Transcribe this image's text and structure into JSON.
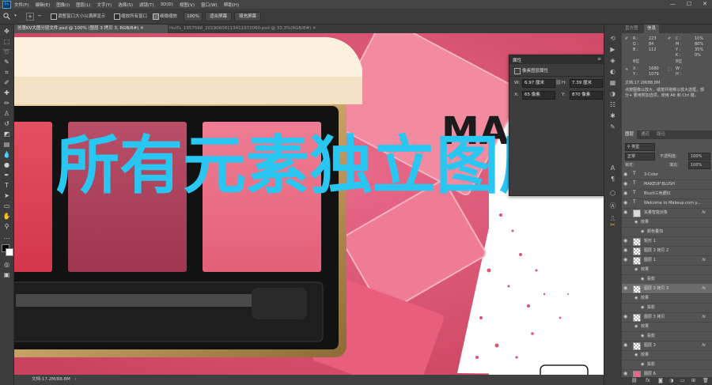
{
  "app": {
    "logo": "Ps",
    "icon_colors": {
      "logo_bg": "#0a3a63",
      "logo_fg": "#31a8ff"
    }
  },
  "menu": [
    "文件(F)",
    "编辑(E)",
    "图像(I)",
    "图层(L)",
    "文字(Y)",
    "选择(S)",
    "滤镜(T)",
    "3D(D)",
    "视图(V)",
    "窗口(W)",
    "帮助(H)"
  ],
  "window_controls": {
    "minimize": "—",
    "maximize": "☐",
    "close": "✕"
  },
  "options": {
    "resize_windows": "调整窗口大小以满屏显示",
    "zoom_all": "缩放所有窗口",
    "scrubby_zoom": "细微缩放",
    "zoom_value": "100%",
    "fit_screen": "适合屏幕",
    "fill_screen": "填充屏幕"
  },
  "tabs": [
    {
      "label": "创意KV大图分层文件.psd @ 100% (图层 3 拷贝 3, RGB/8#) ✕"
    },
    {
      "label": "HuiTu_1957566_20190608113411972060.psd @ 33.3%(RGB/8#) ✕"
    }
  ],
  "canvas": {
    "overlay_text": "所有元素独立图层",
    "overlay_color": "#29c6f2",
    "headline_partial": "MA"
  },
  "status": {
    "text": "文档:17.2M/88.8M",
    "arrow": "›"
  },
  "histogram_panel": {
    "tabs": [
      "直方图",
      "信息"
    ],
    "r_label": "R :",
    "r": "223",
    "g_label": "G :",
    "g": "84",
    "b_label": "B :",
    "b": "112",
    "c_label": "C :",
    "c": "10%",
    "m_label": "M :",
    "m": "80%",
    "y_label": "Y :",
    "y": "35%",
    "k_label": "K :",
    "k": "0%",
    "depth1": "8位",
    "depth2": "8位",
    "x_label": "X :",
    "x": "1680",
    "y2_label": "Y :",
    "y2": "1079",
    "w_label": "W :",
    "h_label": "H :",
    "doc": "文档:17.2M/88.8M",
    "hint": "点按图像以放大，或按并拖移以放大选框，部分+ 要用附加选项，使用 Alt 和 Ctrl 键。"
  },
  "properties": {
    "title": "属性",
    "subtitle": "像素图层属性",
    "w_label": "W:",
    "w": "6.97 厘米",
    "h_label": "H:",
    "h": "7.39 厘米",
    "x_label": "X:",
    "x": "65 像素",
    "y_label": "Y:",
    "y": "870 像素",
    "link_icon": "⛓"
  },
  "layers_panel": {
    "tabs": [
      "图层",
      "通道",
      "路径"
    ],
    "kind": "类型",
    "blend_mode": "正常",
    "opacity_label": "不透明度:",
    "opacity": "100%",
    "lock_label": "锁定:",
    "fill_label": "填充:",
    "fill": "100%",
    "fx": "fx",
    "layers": [
      {
        "name": "3-Color",
        "type": "text"
      },
      {
        "name": "MAKEUP BLUSH",
        "type": "text"
      },
      {
        "name": "Blush三色腮红",
        "type": "text"
      },
      {
        "name": "Welcome to Makeup.com y...",
        "type": "text"
      },
      {
        "name": "矢量智能对象",
        "type": "smart",
        "fx": true
      },
      {
        "name": "效果",
        "type": "effect"
      },
      {
        "name": "颜色叠加",
        "type": "effect-item"
      },
      {
        "name": "矩形 1",
        "type": "shape"
      },
      {
        "name": "图层 3 拷贝 2",
        "type": "pixel"
      },
      {
        "name": "图层 1",
        "type": "pixel",
        "fx": true
      },
      {
        "name": "效果",
        "type": "effect"
      },
      {
        "name": "投影",
        "type": "effect-item"
      },
      {
        "name": "图层 3 拷贝 3",
        "type": "pixel",
        "fx": true,
        "selected": true
      },
      {
        "name": "效果",
        "type": "effect"
      },
      {
        "name": "投影",
        "type": "effect-item"
      },
      {
        "name": "图层 3 拷贝",
        "type": "pixel",
        "fx": true
      },
      {
        "name": "效果",
        "type": "effect"
      },
      {
        "name": "投影",
        "type": "effect-item"
      },
      {
        "name": "图层 3",
        "type": "pixel",
        "fx": true
      },
      {
        "name": "效果",
        "type": "effect"
      },
      {
        "name": "投影",
        "type": "effect-item"
      },
      {
        "name": "图层 6",
        "type": "pixel"
      }
    ]
  }
}
